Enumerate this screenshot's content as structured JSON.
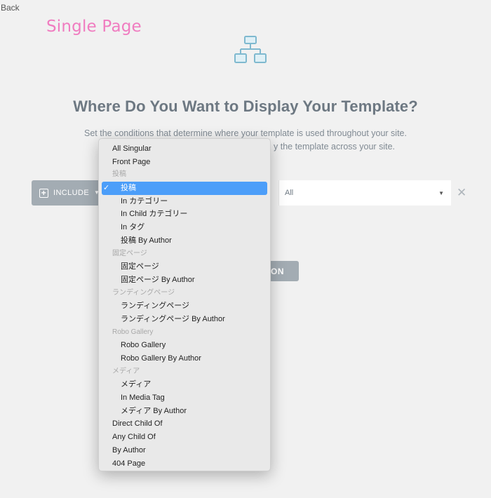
{
  "nav": {
    "back_label": "Back"
  },
  "overlay": {
    "title": "Single Page",
    "color": "#f07cc0"
  },
  "heading": {
    "title": "Where Do You Want to Display Your Template?",
    "description_line1": "Set the conditions that determine where your template is used throughout your site.",
    "description_line2_visible": "y the template across your site."
  },
  "condition": {
    "include_label": "INCLUDE",
    "sub_value": "All"
  },
  "add_button_visible": "ON",
  "dropdown": {
    "selected": "投稿",
    "options": [
      {
        "label": "All Singular",
        "kind": "option"
      },
      {
        "label": "Front Page",
        "kind": "option"
      },
      {
        "label": "投稿",
        "kind": "group"
      },
      {
        "label": "投稿",
        "kind": "selected"
      },
      {
        "label": "In カテゴリー",
        "kind": "indent"
      },
      {
        "label": "In Child カテゴリー",
        "kind": "indent"
      },
      {
        "label": "In タグ",
        "kind": "indent"
      },
      {
        "label": "投稿 By Author",
        "kind": "indent"
      },
      {
        "label": "固定ページ",
        "kind": "group"
      },
      {
        "label": "固定ページ",
        "kind": "indent"
      },
      {
        "label": "固定ページ By Author",
        "kind": "indent"
      },
      {
        "label": "ランディングページ",
        "kind": "group"
      },
      {
        "label": "ランディングページ",
        "kind": "indent"
      },
      {
        "label": "ランディングページ By Author",
        "kind": "indent"
      },
      {
        "label": "Robo Gallery",
        "kind": "group"
      },
      {
        "label": "Robo Gallery",
        "kind": "indent"
      },
      {
        "label": "Robo Gallery By Author",
        "kind": "indent"
      },
      {
        "label": "メディア",
        "kind": "group"
      },
      {
        "label": "メディア",
        "kind": "indent"
      },
      {
        "label": "In Media Tag",
        "kind": "indent"
      },
      {
        "label": "メディア By Author",
        "kind": "indent"
      },
      {
        "label": "Direct Child Of",
        "kind": "option"
      },
      {
        "label": "Any Child Of",
        "kind": "option"
      },
      {
        "label": "By Author",
        "kind": "option"
      },
      {
        "label": "404 Page",
        "kind": "option"
      }
    ]
  },
  "icons": {
    "hero": "sitemap-icon",
    "remove": "close-icon",
    "include": "plus-square-icon"
  },
  "colors": {
    "accent": "#4c9ef9",
    "button": "#a3acb3",
    "background": "#f1f1f1",
    "icon": "#7fb9cf"
  }
}
